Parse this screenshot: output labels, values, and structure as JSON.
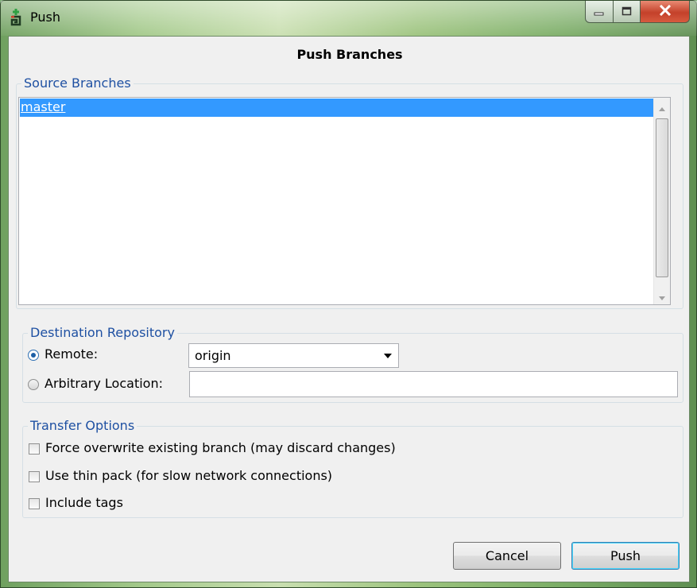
{
  "window": {
    "title": "Push",
    "icon": "egit-push-icon",
    "controls": [
      "minimize-icon",
      "maximize-icon",
      "close-icon"
    ]
  },
  "dialog": {
    "heading": "Push Branches"
  },
  "source_branches": {
    "label": "Source Branches",
    "items": [
      {
        "name": "master",
        "selected": true
      }
    ]
  },
  "destination": {
    "label": "Destination Repository",
    "remote_label": "Remote:",
    "remote_value": "origin",
    "remote_selected": true,
    "arbitrary_label": "Arbitrary Location:",
    "arbitrary_value": ""
  },
  "transfer": {
    "label": "Transfer Options",
    "options": [
      {
        "label": "Force overwrite existing branch (may discard changes)",
        "checked": false
      },
      {
        "label": "Use thin pack (for slow network connections)",
        "checked": false
      },
      {
        "label": "Include tags",
        "checked": false
      }
    ]
  },
  "buttons": {
    "cancel": "Cancel",
    "push": "Push"
  },
  "colors": {
    "selection": "#3399ff",
    "group_label": "#1e50a2",
    "dialog_bg": "#f0f0f0"
  }
}
